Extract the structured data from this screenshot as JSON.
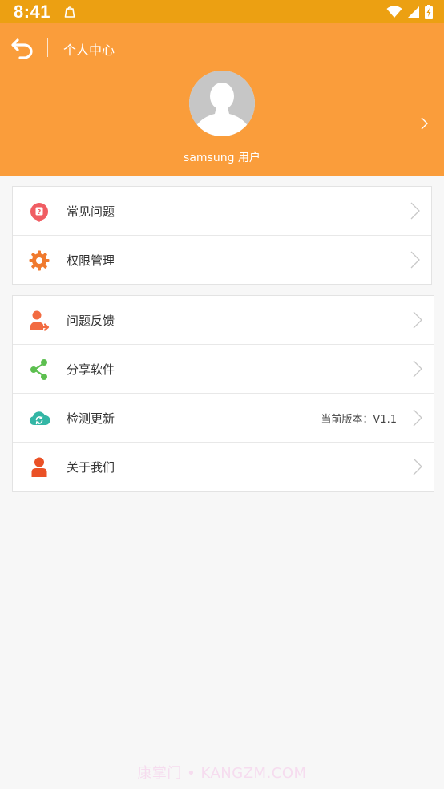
{
  "status_bar": {
    "time": "8:41",
    "icons": [
      "notification-bag-icon",
      "wifi-icon",
      "signal-icon",
      "battery-icon"
    ]
  },
  "header": {
    "title": "个人中心",
    "username": "samsung 用户",
    "back_icon": "back-arrow-icon",
    "avatar_icon": "default-avatar-icon",
    "chevron_icon": "chevron-right-icon"
  },
  "menu_group_1": {
    "items": [
      {
        "label": "常见问题",
        "icon": "faq-bubble-icon"
      },
      {
        "label": "权限管理",
        "icon": "gear-icon"
      }
    ]
  },
  "menu_group_2": {
    "items": [
      {
        "label": "问题反馈",
        "icon": "feedback-user-icon"
      },
      {
        "label": "分享软件",
        "icon": "share-icon"
      },
      {
        "label": "检测更新",
        "icon": "cloud-sync-icon",
        "value": "当前版本：V1.1"
      },
      {
        "label": "关于我们",
        "icon": "user-icon"
      }
    ]
  },
  "watermark": "康掌门 • KANGZM.COM",
  "colors": {
    "status_bar": "#eca012",
    "header": "#fa9d3b",
    "background": "#f7f7f7",
    "faq_icon": "#f05d63",
    "gear_icon": "#f07a2e",
    "feedback_icon": "#f26b41",
    "share_icon": "#5cbf4f",
    "update_icon": "#33b6a5",
    "about_icon": "#ea5126"
  }
}
